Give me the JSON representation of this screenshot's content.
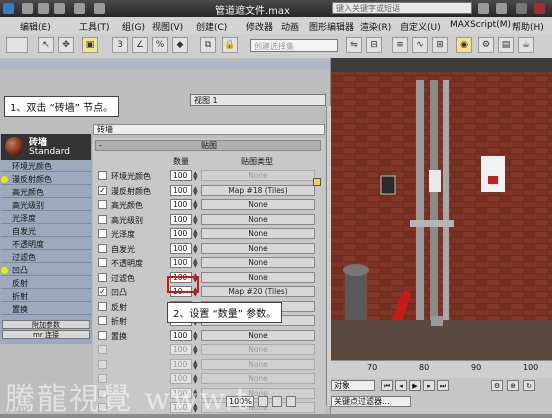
{
  "window": {
    "title": "管道遮文件.max",
    "search_placeholder": "键入关键字或短语"
  },
  "menubar": {
    "items": [
      "编辑(E)",
      "工具(T)",
      "组(G)",
      "视图(V)",
      "创建(C)",
      "修改器",
      "动画",
      "图形编辑器",
      "渲染(R)",
      "自定义(U)",
      "MAXScript(M)",
      "帮助(H)"
    ]
  },
  "toolbar": {
    "selection_set_placeholder": "创建选择集"
  },
  "editor": {
    "view_selector": "视图 1",
    "callout_1": "1、双击 “砖墙” 节点。",
    "callout_2": "2、设置 “数量” 参数。",
    "material_name": "砖墙",
    "node_list": {
      "header_name": "砖墙",
      "header_type": "Standard",
      "rows": [
        {
          "label": "环境光颜色",
          "dot": false
        },
        {
          "label": "漫反射颜色",
          "dot": true
        },
        {
          "label": "高光颜色",
          "dot": false
        },
        {
          "label": "高光级别",
          "dot": false
        },
        {
          "label": "光泽度",
          "dot": false
        },
        {
          "label": "自发光",
          "dot": false
        },
        {
          "label": "不透明度",
          "dot": false
        },
        {
          "label": "过滤色",
          "dot": false
        },
        {
          "label": "凹凸",
          "dot": true
        },
        {
          "label": "反射",
          "dot": false
        },
        {
          "label": "折射",
          "dot": false
        },
        {
          "label": "置换",
          "dot": false
        }
      ],
      "btn_extra": "附加参数",
      "btn_mr": "mr 连接"
    },
    "maps": {
      "rollout_title": "贴图",
      "col_amount": "数量",
      "col_type": "贴图类型",
      "rows": [
        {
          "label": "环境光颜色",
          "checked": false,
          "enabled": true,
          "amount": "100",
          "map": "None",
          "map_enabled": false
        },
        {
          "label": "漫反射颜色",
          "checked": true,
          "enabled": true,
          "amount": "100",
          "map": "Map #18  (Tiles)",
          "map_enabled": true
        },
        {
          "label": "高光颜色",
          "checked": false,
          "enabled": true,
          "amount": "100",
          "map": "None",
          "map_enabled": true
        },
        {
          "label": "高光级别",
          "checked": false,
          "enabled": true,
          "amount": "100",
          "map": "None",
          "map_enabled": true
        },
        {
          "label": "光泽度",
          "checked": false,
          "enabled": true,
          "amount": "100",
          "map": "None",
          "map_enabled": true
        },
        {
          "label": "自发光",
          "checked": false,
          "enabled": true,
          "amount": "100",
          "map": "None",
          "map_enabled": true
        },
        {
          "label": "不透明度",
          "checked": false,
          "enabled": true,
          "amount": "100",
          "map": "None",
          "map_enabled": true
        },
        {
          "label": "过滤色",
          "checked": false,
          "enabled": true,
          "amount": "100",
          "map": "None",
          "map_enabled": true
        },
        {
          "label": "凹凸",
          "checked": true,
          "enabled": true,
          "amount": "10",
          "map": "Map #20  (Tiles)",
          "map_enabled": true
        },
        {
          "label": "反射",
          "checked": false,
          "enabled": true,
          "amount": "100",
          "map": "None",
          "map_enabled": true
        },
        {
          "label": "折射",
          "checked": false,
          "enabled": true,
          "amount": "100",
          "map": "None",
          "map_enabled": true
        },
        {
          "label": "置换",
          "checked": false,
          "enabled": true,
          "amount": "100",
          "map": "None",
          "map_enabled": true
        },
        {
          "label": "",
          "checked": false,
          "enabled": false,
          "amount": "100",
          "map": "None",
          "map_enabled": false
        },
        {
          "label": "",
          "checked": false,
          "enabled": false,
          "amount": "100",
          "map": "None",
          "map_enabled": false
        },
        {
          "label": "",
          "checked": false,
          "enabled": false,
          "amount": "100",
          "map": "None",
          "map_enabled": false
        },
        {
          "label": "",
          "checked": false,
          "enabled": false,
          "amount": "100",
          "map": "None",
          "map_enabled": false
        },
        {
          "label": "",
          "checked": false,
          "enabled": false,
          "amount": "100",
          "map": "None",
          "map_enabled": false
        }
      ]
    },
    "zoom": "100%"
  },
  "timeline": {
    "ticks": [
      "70",
      "80",
      "90",
      "100"
    ],
    "mode_label": "对象",
    "filter_label": "关键点过滤器..."
  },
  "watermark": "騰龍視覺  www.t",
  "colors": {
    "brick": "#6e2a1e",
    "highlight_red": "#e01010",
    "node_dot": "#e2f000"
  }
}
